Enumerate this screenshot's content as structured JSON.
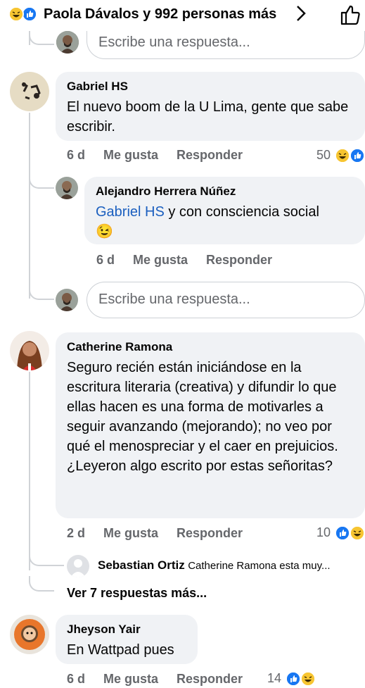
{
  "header": {
    "title": "Paola Dávalos y 992 personas más",
    "reaction_icons": [
      "haha-icon",
      "like-icon"
    ],
    "chevron": "›",
    "like_button_icon": "thumbs-up-outline-icon"
  },
  "reply_input": {
    "placeholder": "Escribe una respuesta..."
  },
  "comments": [
    {
      "author": "Gabriel HS",
      "text": "El nuevo boom de la U Lima, gente que sabe escribir.",
      "time": "6 d",
      "like_label": "Me gusta",
      "reply_label": "Responder",
      "reaction_count": "50",
      "replies": [
        {
          "author": "Alejandro Herrera Núñez",
          "mention": "Gabriel HS",
          "text": " y con consciencia social",
          "emoji": "😉",
          "time": "6 d",
          "like_label": "Me gusta",
          "reply_label": "Responder"
        }
      ]
    },
    {
      "author": "Catherine Ramona",
      "text": "Seguro recién están iniciándose en la escritura literaria (creativa) y difundir lo que ellas hacen es una forma de motivarles a seguir avanzando (mejorando); no veo por qué el menospreciar y el caer en prejuicios. ¿Leyeron algo escrito por estas señoritas?",
      "time": "2 d",
      "like_label": "Me gusta",
      "reply_label": "Responder",
      "reaction_count": "10",
      "collapsed_reply": {
        "author": "Sebastian Ortiz",
        "text": "Catherine Ramona esta muy..."
      },
      "more_replies_label": "Ver 7 respuestas más..."
    },
    {
      "author": "Jheyson Yair",
      "text": "En Wattpad pues",
      "time": "6 d",
      "like_label": "Me gusta",
      "reply_label": "Responder",
      "reaction_count": "14"
    }
  ],
  "colors": {
    "bubble": "#f0f2f5",
    "secondary_text": "#65676b",
    "mention": "#1b5fbf",
    "like_blue": "#1877f2",
    "haha_yellow": "#f7c531",
    "thread_line": "#d0d3d7"
  }
}
